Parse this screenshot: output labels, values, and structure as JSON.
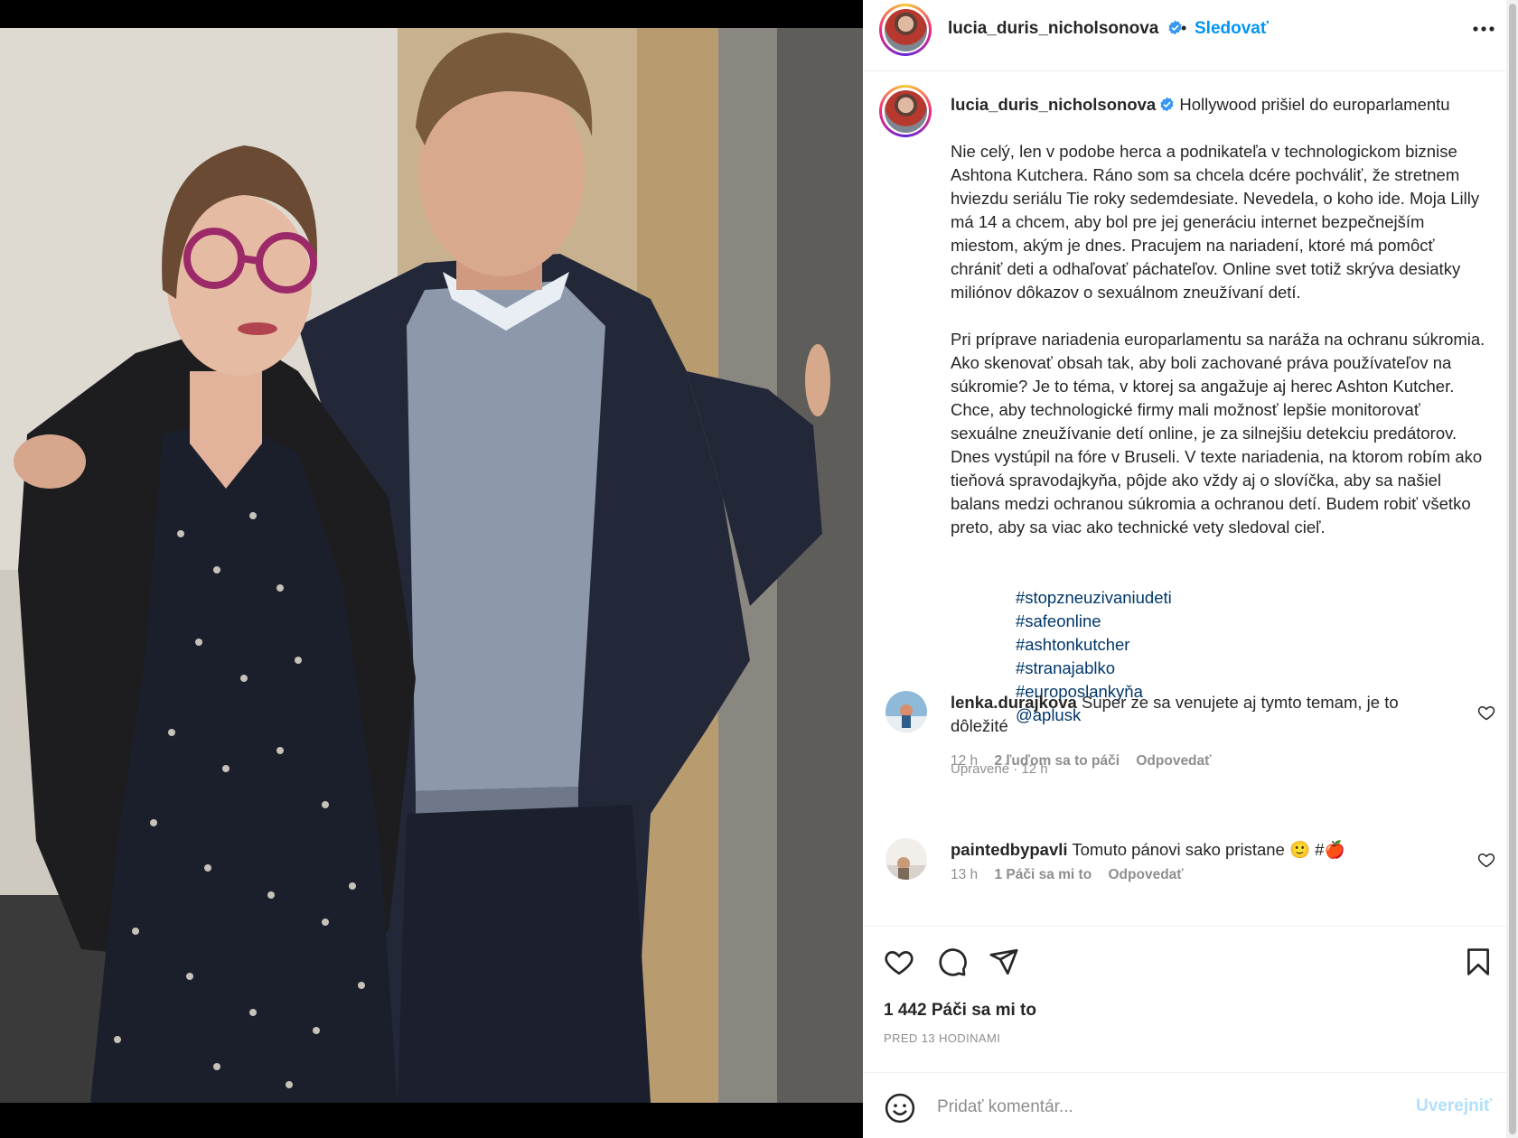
{
  "post": {
    "username": "lucia_duris_nicholsonova",
    "follow_label": "Sledovať",
    "separator": "•"
  },
  "caption": {
    "username": "lucia_duris_nicholsonova",
    "headline": "Hollywood prišiel do europarlamentu",
    "paragraph1": "Nie celý, len v podobe herca a podnikateľa v technologickom biznise Ashtona Kutchera. Ráno som sa chcela dcére pochváliť, že stretnem hviezdu seriálu Tie roky sedemdesiate. Nevedela, o koho ide. Moja Lilly má 14 a chcem, aby bol pre jej generáciu internet bezpečnejším miestom, akým je dnes. Pracujem na nariadení, ktoré má pomôcť chrániť deti a odhaľovať páchateľov. Online svet totiž skrýva desiatky miliónov dôkazov o sexuálnom zneužívaní detí.",
    "paragraph2": "Pri príprave nariadenia europarlamentu sa naráža na ochranu súkromia. Ako skenovať obsah tak, aby boli zachované práva používateľov na súkromie? Je to téma, v ktorej sa angažuje aj herec Ashton Kutcher. Chce, aby technologické firmy mali možnosť lepšie monitorovať sexuálne zneužívanie detí online, je za silnejšiu detekciu predátorov. Dnes vystúpil na fóre v Bruseli. V texte nariadenia, na ktorom robím ako tieňová spravodajkyňa, pôjde ako vždy aj o slovíčka, aby sa našiel balans medzi ochranou súkromia a ochranou detí. Budem robiť všetko preto, aby sa viac ako technické vety sledoval cieľ.",
    "tags": [
      "#stopzneuzivaniudeti",
      "#safeonline",
      "#ashtonkutcher",
      "#stranajablko",
      "#europoslankyňa",
      "@aplusk"
    ],
    "meta": "Upravené · 12 h"
  },
  "comments": [
    {
      "username": "lenka.durajkova",
      "text": "Super ze sa venujete aj tymto temam, je to dôležité",
      "time": "12 h",
      "likes": "2 ľuďom sa to páči",
      "reply": "Odpovedať"
    },
    {
      "username": "paintedbypavli",
      "text": "Tomuto pánovi sako pristane 🙂 #🍎",
      "time": "13 h",
      "likes": "1 Páči sa mi to",
      "reply": "Odpovedať"
    }
  ],
  "stats": {
    "likes": "1 442 Páči sa mi to",
    "posted": "PRED 13 HODINAMI"
  },
  "add_comment": {
    "placeholder": "Pridať komentár...",
    "post_label": "Uverejniť"
  },
  "icons": {
    "verified": "verified-badge-icon",
    "more": "more-options-icon",
    "like": "heart-icon",
    "comment": "comment-bubble-icon",
    "share": "paper-plane-icon",
    "save": "bookmark-icon",
    "emoji": "smiley-icon"
  },
  "colors": {
    "accent": "#0095f6",
    "hashtag": "#00376b",
    "muted": "#8e8e8e",
    "post_disabled": "#b2dffc"
  }
}
